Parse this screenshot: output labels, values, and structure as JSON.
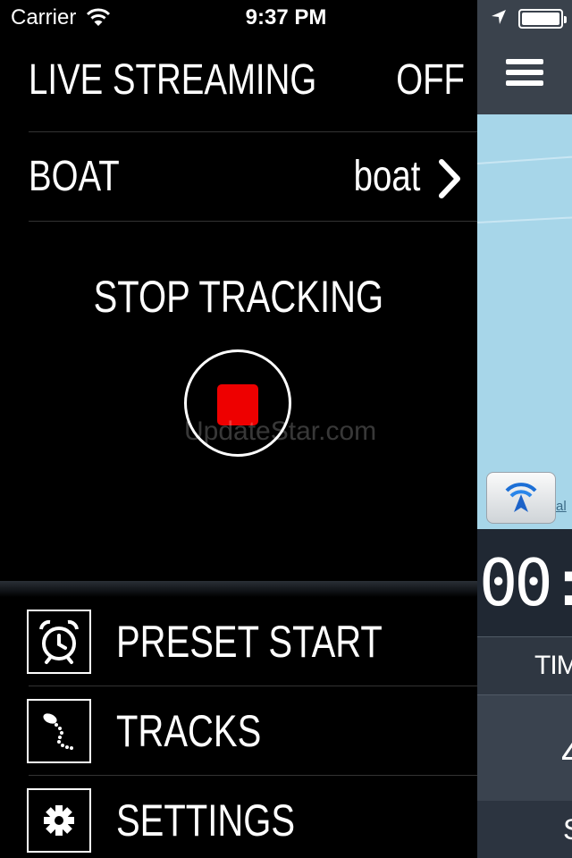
{
  "status_bar": {
    "carrier": "Carrier",
    "time": "9:37 PM",
    "icons": [
      "wifi-icon",
      "location-arrow-icon",
      "battery-icon"
    ]
  },
  "drawer": {
    "live_streaming": {
      "label": "LIVE STREAMING",
      "value": "OFF"
    },
    "boat": {
      "label": "BOAT",
      "value": "boat",
      "icon": "chevron-right-icon"
    },
    "tracking": {
      "title": "STOP TRACKING",
      "button_icon": "stop-icon",
      "accent_color": "#ee0000"
    },
    "watermark": "UpdateStar.com",
    "menu": [
      {
        "label": "PRESET START",
        "icon": "alarm-clock-icon"
      },
      {
        "label": "TRACKS",
        "icon": "track-path-icon"
      },
      {
        "label": "SETTINGS",
        "icon": "gear-icon"
      }
    ]
  },
  "background_view": {
    "menu_icon": "hamburger-icon",
    "map_legal_text": "al",
    "timer": "00:",
    "column_header": "TIM",
    "cell_value": "4",
    "footer_letter": "S",
    "colors": {
      "map": "#a7d6e9",
      "panel": "#2c3440"
    }
  }
}
